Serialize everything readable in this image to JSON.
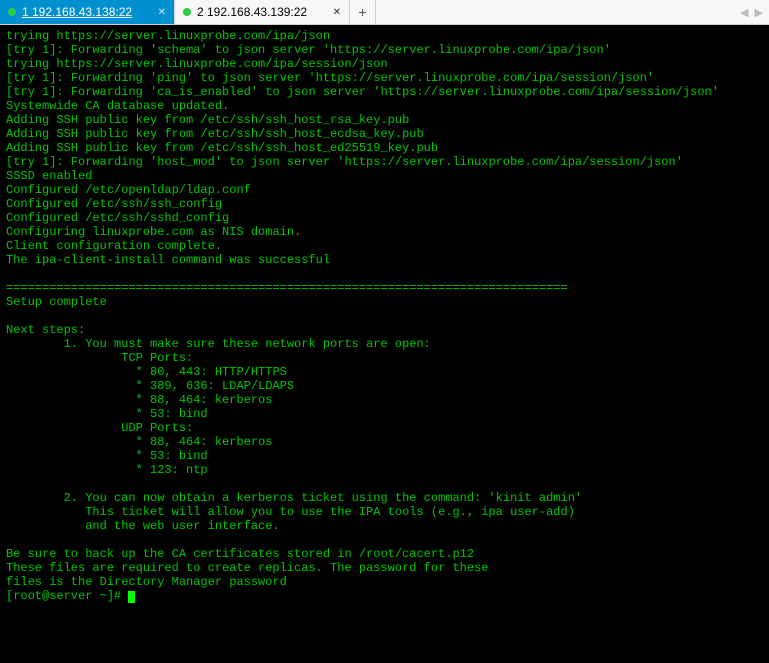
{
  "tabs": [
    {
      "label": "1 192.168.43.138:22",
      "active": true
    },
    {
      "label": "2 192.168.43.139:22",
      "active": false
    }
  ],
  "add_tab_glyph": "+",
  "nav": {
    "left": "◀",
    "right": "▶"
  },
  "colors": {
    "tab_active_bg": "#0090d0",
    "terminal_bg": "#000000",
    "terminal_fg": "#00c800",
    "status_dot": "#2ecc40"
  },
  "terminal": {
    "lines": [
      "trying https://server.linuxprobe.com/ipa/json",
      "[try 1]: Forwarding 'schema' to json server 'https://server.linuxprobe.com/ipa/json'",
      "trying https://server.linuxprobe.com/ipa/session/json",
      "[try 1]: Forwarding 'ping' to json server 'https://server.linuxprobe.com/ipa/session/json'",
      "[try 1]: Forwarding 'ca_is_enabled' to json server 'https://server.linuxprobe.com/ipa/session/json'",
      "Systemwide CA database updated.",
      "Adding SSH public key from /etc/ssh/ssh_host_rsa_key.pub",
      "Adding SSH public key from /etc/ssh/ssh_host_ecdsa_key.pub",
      "Adding SSH public key from /etc/ssh/ssh_host_ed25519_key.pub",
      "[try 1]: Forwarding 'host_mod' to json server 'https://server.linuxprobe.com/ipa/session/json'",
      "SSSD enabled",
      "Configured /etc/openldap/ldap.conf",
      "Configured /etc/ssh/ssh_config",
      "Configured /etc/ssh/sshd_config",
      "Configuring linuxprobe.com as NIS domain.",
      "Client configuration complete.",
      "The ipa-client-install command was successful",
      "",
      "==============================================================================",
      "Setup complete",
      "",
      "Next steps:",
      "        1. You must make sure these network ports are open:",
      "                TCP Ports:",
      "                  * 80, 443: HTTP/HTTPS",
      "                  * 389, 636: LDAP/LDAPS",
      "                  * 88, 464: kerberos",
      "                  * 53: bind",
      "                UDP Ports:",
      "                  * 88, 464: kerberos",
      "                  * 53: bind",
      "                  * 123: ntp",
      "",
      "        2. You can now obtain a kerberos ticket using the command: 'kinit admin'",
      "           This ticket will allow you to use the IPA tools (e.g., ipa user-add)",
      "           and the web user interface.",
      "",
      "Be sure to back up the CA certificates stored in /root/cacert.p12",
      "These files are required to create replicas. The password for these",
      "files is the Directory Manager password"
    ],
    "prompt": "[root@server ~]# "
  }
}
